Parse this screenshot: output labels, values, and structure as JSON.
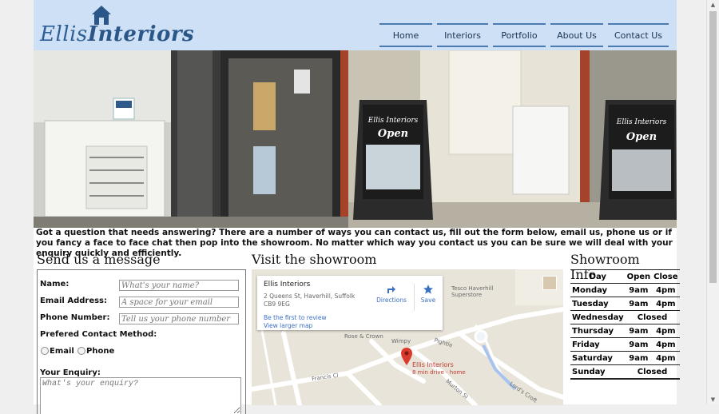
{
  "brand": {
    "name_a": "Ellis",
    "name_b": "Interiors",
    "color": "#2f5f94"
  },
  "nav": [
    {
      "label": "Home"
    },
    {
      "label": "Interiors"
    },
    {
      "label": "Portfolio"
    },
    {
      "label": "About Us"
    },
    {
      "label": "Contact Us"
    }
  ],
  "intro": "Got a question that needs answering? There are a number of ways you can contact us, fill out the form below, email us, phone us or if you fancy a face to face chat then pop into the showroom. No matter which way you contact us you can be sure we will deal with your enquiry quickly and efficiently.",
  "message": {
    "title": "Send us a message",
    "name_label": "Name:",
    "name_placeholder": "What's your name?",
    "email_label": "Email Address:",
    "email_placeholder": "A space for your email",
    "phone_label": "Phone Number:",
    "phone_placeholder": "Tell us your phone number",
    "contact_method_label": "Prefered Contact Method:",
    "opt_email": "Email",
    "opt_phone": "Phone",
    "enquiry_label": "Your Enquiry:",
    "enquiry_placeholder": "What's your enquiry?"
  },
  "showroom": {
    "title": "Visit the showroom",
    "card_title": "Ellis Interiors",
    "card_address": "2 Queens St, Haverhill, Suffolk CB9 9EG",
    "review_link": "Be the first to review",
    "larger_map_link": "View larger map",
    "directions": "Directions",
    "save": "Save",
    "map_labels": {
      "tesco": "Tesco Haverhill Superstore",
      "rose": "Rose & Crown",
      "wimpy": "Wimpy",
      "pin_name": "Ellis Interiors",
      "pin_sub": "8 min drive - home",
      "pightle": "Pightle",
      "francis": "Francis Cl",
      "lords": "Lord's Croft",
      "murton": "Murton Sl"
    }
  },
  "hours": {
    "title": "Showroom Info",
    "headers": [
      "Day",
      "Open",
      "Close"
    ],
    "rows": [
      {
        "day": "Monday",
        "open": "9am",
        "close": "4pm"
      },
      {
        "day": "Tuesday",
        "open": "9am",
        "close": "4pm"
      },
      {
        "day": "Wednesday",
        "closed": "Closed"
      },
      {
        "day": "Thursday",
        "open": "9am",
        "close": "4pm"
      },
      {
        "day": "Friday",
        "open": "9am",
        "close": "4pm"
      },
      {
        "day": "Saturday",
        "open": "9am",
        "close": "4pm"
      },
      {
        "day": "Sunday",
        "closed": "Closed"
      }
    ]
  },
  "hero": {
    "sign_a": "Ellis",
    "sign_b": "Interiors",
    "sign_open": "Open"
  },
  "icons": [
    "house-icon",
    "directions-icon",
    "star-icon",
    "map-pin-icon",
    "avatar-icon"
  ]
}
